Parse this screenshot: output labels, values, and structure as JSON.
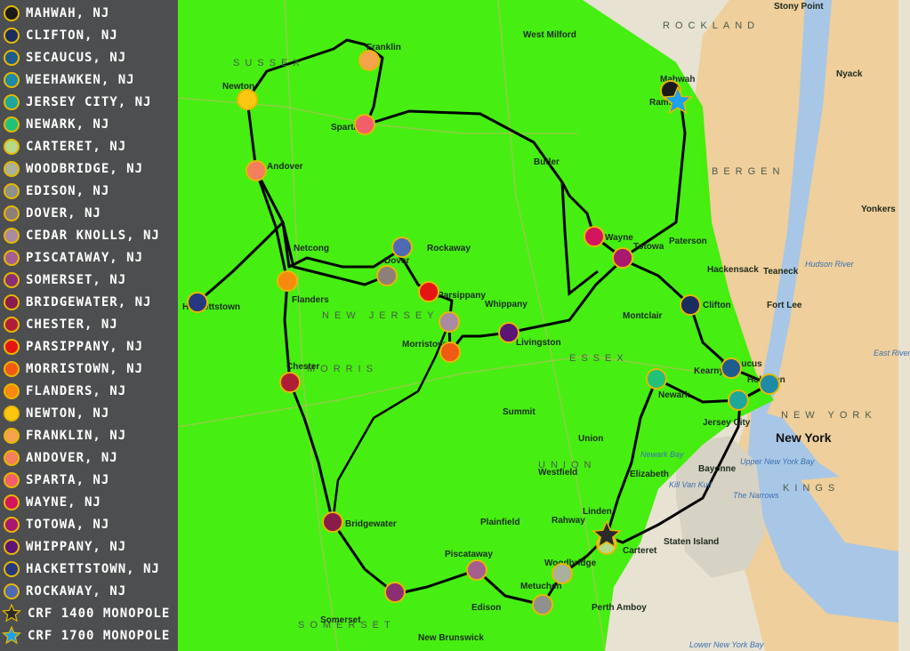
{
  "colors": {
    "coverage_green": "#38f000",
    "route_line": "#000000",
    "marker_ring": "#e6b800",
    "legend_bg": "#444648",
    "water": "#a8c7e6",
    "urban": "#efcf9b"
  },
  "legend": {
    "sites": [
      {
        "label": "MAHWAH, NJ",
        "color": "#1a1a1a"
      },
      {
        "label": "CLIFTON, NJ",
        "color": "#1b2c5e"
      },
      {
        "label": "SECAUCUS, NJ",
        "color": "#1d5c8c"
      },
      {
        "label": "WEEHAWKEN, NJ",
        "color": "#1f8aa6"
      },
      {
        "label": "JERSEY CITY, NJ",
        "color": "#1da89b"
      },
      {
        "label": "NEWARK, NJ",
        "color": "#22c17a"
      },
      {
        "label": "CARTERET, NJ",
        "color": "#b6d98a"
      },
      {
        "label": "WOODBRIDGE, NJ",
        "color": "#a9b09c"
      },
      {
        "label": "EDISON, NJ",
        "color": "#8e918c"
      },
      {
        "label": "DOVER, NJ",
        "color": "#8e8078"
      },
      {
        "label": "CEDAR KNOLLS, NJ",
        "color": "#a98aa0"
      },
      {
        "label": "PISCATAWAY, NJ",
        "color": "#a45f90"
      },
      {
        "label": "SOMERSET, NJ",
        "color": "#8c2f72"
      },
      {
        "label": "BRIDGEWATER, NJ",
        "color": "#8a1c4c"
      },
      {
        "label": "CHESTER, NJ",
        "color": "#b01d38"
      },
      {
        "label": "PARSIPPANY, NJ",
        "color": "#e61515"
      },
      {
        "label": "MORRISTOWN, NJ",
        "color": "#f05a13"
      },
      {
        "label": "FLANDERS, NJ",
        "color": "#f7890f"
      },
      {
        "label": "NEWTON, NJ",
        "color": "#fcc712"
      },
      {
        "label": "FRANKLIN, NJ",
        "color": "#f6a14c"
      },
      {
        "label": "ANDOVER, NJ",
        "color": "#f47f5c"
      },
      {
        "label": "SPARTA, NJ",
        "color": "#f25f6a"
      },
      {
        "label": "WAYNE, NJ",
        "color": "#d3145f"
      },
      {
        "label": "TOTOWA, NJ",
        "color": "#a8186e"
      },
      {
        "label": "WHIPPANY, NJ",
        "color": "#5c1476"
      },
      {
        "label": "HACKETTSTOWN, NJ",
        "color": "#273780"
      },
      {
        "label": "ROCKAWAY, NJ",
        "color": "#4f69b3"
      }
    ],
    "monopoles": [
      {
        "label": "CRF 1400 MONOPOLE",
        "color": "#2a2a2a",
        "icon": "star-icon"
      },
      {
        "label": "CRF 1700 MONOPOLE",
        "color": "#1ea0ea",
        "icon": "star-icon"
      }
    ]
  },
  "map": {
    "region_labels": [
      "SUSSEX",
      "NEW JERSEY",
      "MORRIS",
      "ESSEX",
      "UNION",
      "SOMERSET",
      "ROCKLAND",
      "BERGEN",
      "KINGS",
      "NEW YORK"
    ],
    "city_labels": [
      "New York",
      "Paterson",
      "Newark",
      "Elizabeth",
      "Jersey City",
      "Staten Island",
      "Yonkers",
      "Morristown",
      "Dover",
      "Sparta",
      "Franklin",
      "Andover",
      "Chester",
      "Parsippany",
      "Wayne",
      "Clifton",
      "Secaucus",
      "Edison",
      "Bridgewater",
      "Somerset",
      "Hackettstown",
      "Newton",
      "Mahwah",
      "Ramsey",
      "Totowa",
      "Carteret",
      "Rahway",
      "Plainfield",
      "New Brunswick",
      "Perth Amboy",
      "Livingston",
      "Montclair",
      "Hackensack",
      "Fort Lee",
      "Nyack",
      "Stony Point",
      "West Milford",
      "Butler",
      "Flanders",
      "Netcong",
      "Rockaway",
      "Whippany",
      "Hoboken",
      "Union",
      "Summit",
      "Westfield",
      "Linden",
      "Woodbridge",
      "Metuchen",
      "Piscataway",
      "Kearny",
      "Bayonne",
      "Teaneck"
    ],
    "water_labels": [
      "Newark Bay",
      "Kill Van Kull",
      "The Narrows",
      "Lower New York Bay",
      "Upper New York Bay",
      "Hudson River",
      "East River"
    ]
  }
}
